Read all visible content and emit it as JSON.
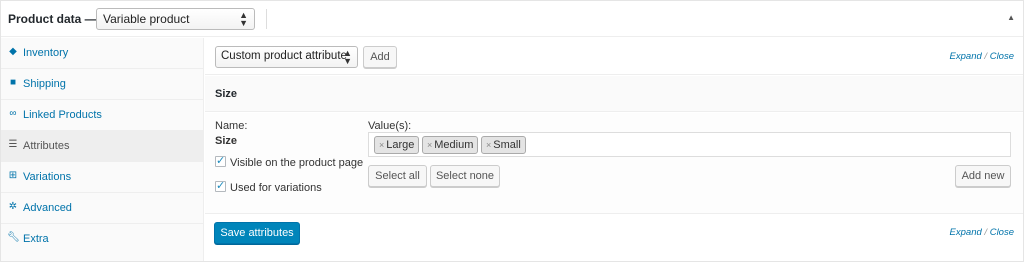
{
  "header": {
    "title": "Product data —",
    "product_type": "Variable product"
  },
  "sidebar": {
    "items": [
      {
        "label": "Inventory",
        "icon": "tag-icon"
      },
      {
        "label": "Shipping",
        "icon": "truck-icon"
      },
      {
        "label": "Linked Products",
        "icon": "link-icon"
      },
      {
        "label": "Attributes",
        "icon": "list-icon"
      },
      {
        "label": "Variations",
        "icon": "grid-icon"
      },
      {
        "label": "Advanced",
        "icon": "gear-icon"
      },
      {
        "label": "Extra",
        "icon": "wrench-icon"
      }
    ],
    "active": "Attributes"
  },
  "toolbar": {
    "attribute_select": "Custom product attribute",
    "add_label": "Add",
    "expand": "Expand",
    "sep": "/",
    "close": "Close"
  },
  "attribute": {
    "heading": "Size",
    "name_label": "Name:",
    "name_value": "Size",
    "visible_label": "Visible on the product page",
    "visible_checked": true,
    "variations_label": "Used for variations",
    "variations_checked": true,
    "values_label": "Value(s):",
    "values": [
      "Large",
      "Medium",
      "Small"
    ],
    "select_all": "Select all",
    "select_none": "Select none",
    "add_new": "Add new"
  },
  "footer": {
    "save_label": "Save attributes",
    "expand": "Expand",
    "sep": "/",
    "close": "Close"
  },
  "colors": {
    "link": "#0073aa",
    "primary_button": "#0085ba"
  }
}
